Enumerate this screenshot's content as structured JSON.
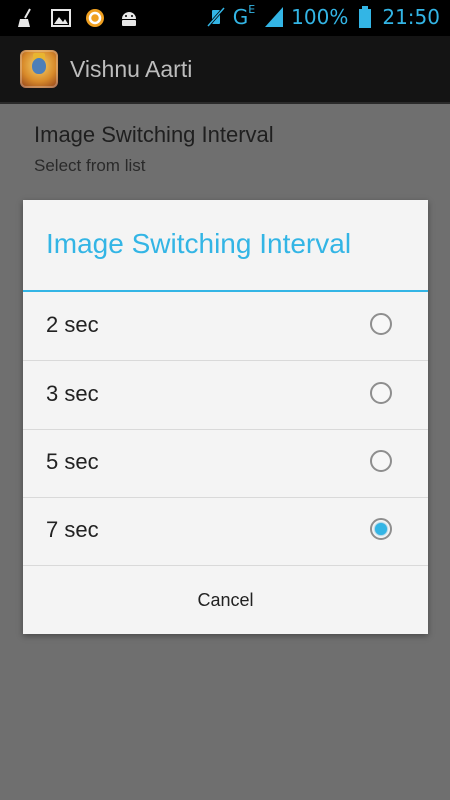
{
  "status_bar": {
    "network": "G",
    "network_sup": "E",
    "battery": "100%",
    "time": "21:50",
    "left_icons": [
      "broom-icon",
      "image-icon",
      "circle-app-icon",
      "android-icon"
    ]
  },
  "app_bar": {
    "title": "Vishnu Aarti"
  },
  "preference": {
    "title": "Image Switching Interval",
    "summary": "Select from list"
  },
  "dialog": {
    "title": "Image Switching Interval",
    "options": [
      {
        "label": "2 sec",
        "checked": false
      },
      {
        "label": "3 sec",
        "checked": false
      },
      {
        "label": "5 sec",
        "checked": false
      },
      {
        "label": "7 sec",
        "checked": true
      }
    ],
    "cancel_label": "Cancel"
  },
  "colors": {
    "accent": "#33b5e5",
    "scrim": "#6f6f6f",
    "dialog_bg": "#f4f4f4"
  }
}
